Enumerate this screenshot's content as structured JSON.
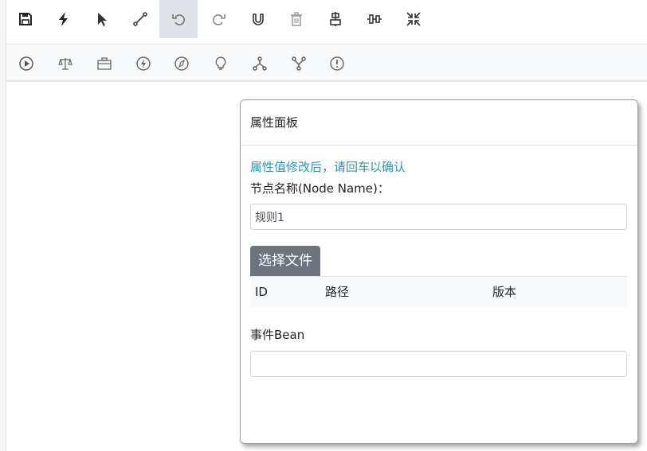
{
  "toolbar_top": [
    {
      "id": "save",
      "icon": "save-icon"
    },
    {
      "id": "lightning",
      "icon": "lightning-icon"
    },
    {
      "id": "pointer",
      "icon": "cursor-icon"
    },
    {
      "id": "connect",
      "icon": "connector-icon"
    },
    {
      "id": "undo",
      "icon": "undo-icon"
    },
    {
      "id": "redo",
      "icon": "redo-icon"
    },
    {
      "id": "magnet",
      "icon": "magnet-icon"
    },
    {
      "id": "delete",
      "icon": "trash-icon"
    },
    {
      "id": "align-center",
      "icon": "align-center-icon"
    },
    {
      "id": "align-middle",
      "icon": "align-middle-icon"
    },
    {
      "id": "collapse",
      "icon": "collapse-icon"
    }
  ],
  "toolbar_bottom": [
    {
      "id": "start",
      "icon": "play-circle-icon"
    },
    {
      "id": "rule",
      "icon": "scale-icon"
    },
    {
      "id": "task",
      "icon": "briefcase-icon"
    },
    {
      "id": "event",
      "icon": "lightning-circle-icon"
    },
    {
      "id": "script",
      "icon": "compass-icon"
    },
    {
      "id": "decision",
      "icon": "lightbulb-icon"
    },
    {
      "id": "fork",
      "icon": "fork-icon"
    },
    {
      "id": "join",
      "icon": "join-icon"
    },
    {
      "id": "end",
      "icon": "exclamation-circle-icon"
    }
  ],
  "panel": {
    "title": "属性面板",
    "hint": "属性值修改后，请回车以确认",
    "node_name_label": "节点名称(Node Name)：",
    "node_name_value": "规则1",
    "choose_file_label": "选择文件",
    "table_headers": [
      "ID",
      "路径",
      "版本"
    ],
    "event_bean_label": "事件Bean",
    "event_bean_value": ""
  },
  "colors": {
    "hint": "#2a96b0",
    "button": "#6c757d",
    "active_tool": "#dfe3e8"
  }
}
